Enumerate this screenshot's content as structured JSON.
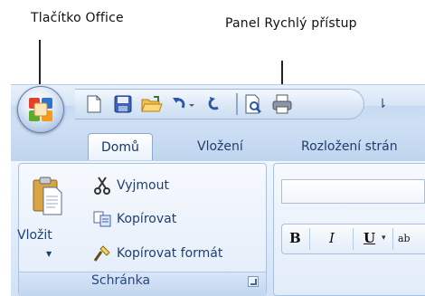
{
  "annotations": {
    "office_button": "Tlačítko Office",
    "quick_access": "Panel Rychlý přístup"
  },
  "tabs": [
    {
      "label": "Domů",
      "active": true
    },
    {
      "label": "Vložení",
      "active": false
    },
    {
      "label": "Rozložení strán",
      "active": false
    }
  ],
  "quick_access_toolbar": {
    "icons": [
      "new-document-icon",
      "save-icon",
      "open-folder-icon",
      "undo-icon",
      "redo-icon",
      "print-preview-icon",
      "print-icon"
    ],
    "more_glyph": "⇂"
  },
  "clipboard_group": {
    "paste_label": "Vložit",
    "paste_arrow": "▼",
    "cut_label": "Vyjmout",
    "copy_label": "Kopírovat",
    "format_painter_label": "Kopírovat formát",
    "group_label": "Schránka"
  },
  "font_group": {
    "bold": "B",
    "italic": "I",
    "underline": "U",
    "underline_arrow": "▾",
    "cut_off_text": "ab"
  },
  "colors": {
    "office_orange": "#f39c1a",
    "office_green": "#5cab2e",
    "office_blue": "#2f74d0",
    "office_red": "#e2402a",
    "ribbon_text": "#1f3f70"
  }
}
